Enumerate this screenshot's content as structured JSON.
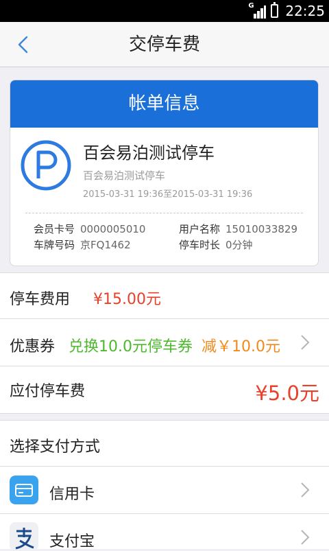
{
  "status_bar": {
    "network": "G",
    "time": "22:25"
  },
  "nav": {
    "title": "交停车费"
  },
  "bill": {
    "header": "帐单信息",
    "lot_name": "百会易泊测试停车",
    "lot_subtitle": "百会易泊测试停车",
    "time_range": "2015-03-31 19:36至2015-03-31 19:36",
    "member_card_label": "会员卡号",
    "member_card_value": "0000005010",
    "user_name_label": "用户名称",
    "user_name_value": "15010033829",
    "plate_label": "车牌号码",
    "plate_value": "京FQ1462",
    "duration_label": "停车时长",
    "duration_value": "0分钟"
  },
  "fee": {
    "label": "停车费用",
    "value": "¥15.00元"
  },
  "coupon": {
    "label": "优惠券",
    "value": "兑换10.0元停车券",
    "discount": "减￥10.0元"
  },
  "due": {
    "label": "应付停车费",
    "value": "¥5.0元"
  },
  "payment": {
    "section_label": "选择支付方式",
    "methods": [
      {
        "label": "信用卡",
        "icon": "credit-card-icon"
      },
      {
        "label": "支付宝",
        "icon": "alipay-icon"
      }
    ]
  },
  "colors": {
    "accent_blue": "#1a6fd8",
    "price_red": "#e8402a",
    "coupon_green": "#4cb82c",
    "coupon_orange": "#f08a1c"
  }
}
